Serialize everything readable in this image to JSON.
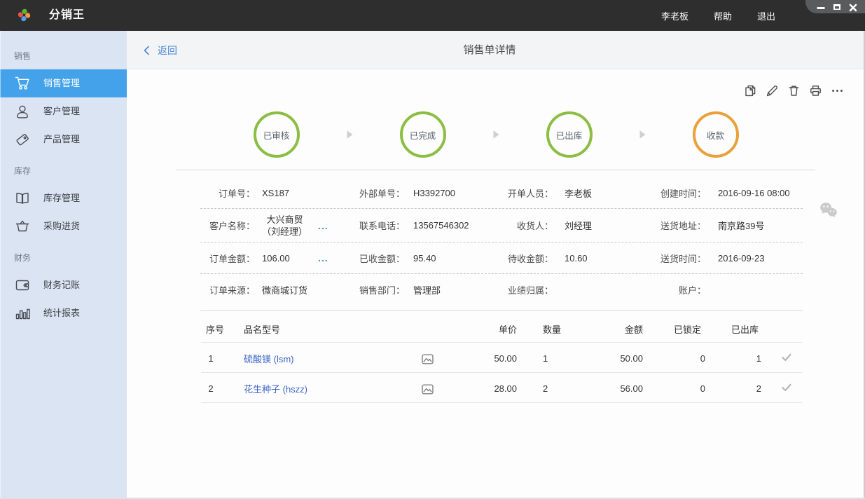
{
  "colors": {
    "topbar_bg": "#2e2e2e",
    "sidebar_bg": "#dbe4f2",
    "sidebar_active_bg": "#43a2e9",
    "header_bg": "#f3f4f5",
    "step_done": "#8cbe43",
    "step_pending": "#e9a13c",
    "back_link_blue": "#4a86d9",
    "product_link_blue": "#3c64c8",
    "more_dots_blue": "#4a90e2"
  },
  "topbar": {
    "logo_icon": "pinwheel-logo",
    "app_title": "分销王",
    "user": "李老板",
    "help": "帮助",
    "logout": "退出"
  },
  "window_controls": {
    "icons": [
      "minimize",
      "maximize",
      "close"
    ]
  },
  "sidebar": {
    "sections": [
      {
        "label": "销售",
        "items": [
          {
            "label": "销售管理",
            "icon": "cart",
            "active": true
          },
          {
            "label": "客户管理",
            "icon": "person",
            "active": false
          },
          {
            "label": "产品管理",
            "icon": "tag",
            "active": false
          }
        ]
      },
      {
        "label": "库存",
        "items": [
          {
            "label": "库存管理",
            "icon": "book",
            "active": false
          },
          {
            "label": "采购进货",
            "icon": "basket",
            "active": false
          }
        ]
      },
      {
        "label": "财务",
        "items": [
          {
            "label": "财务记账",
            "icon": "wallet",
            "active": false
          },
          {
            "label": "统计报表",
            "icon": "barchart",
            "active": false
          }
        ]
      }
    ]
  },
  "page_header": {
    "back_label": "返回",
    "title": "销售单详情"
  },
  "toolbar": {
    "icons": [
      "copy",
      "edit",
      "delete",
      "print",
      "more"
    ]
  },
  "steps": {
    "items": [
      {
        "label": "已审核",
        "state": "done"
      },
      {
        "label": "已完成",
        "state": "done"
      },
      {
        "label": "已出库",
        "state": "done"
      },
      {
        "label": "收款",
        "state": "pending"
      }
    ]
  },
  "order_fields": {
    "rows": [
      [
        {
          "label": "订单号：",
          "value": "XS187"
        },
        {
          "label": "外部单号：",
          "value": "H3392700"
        },
        {
          "label": "开单人员：",
          "value": "李老板"
        },
        {
          "label": "创建时间：",
          "value": "2016-09-16 08:00"
        }
      ],
      [
        {
          "label": "客户名称：",
          "value": "大兴商贸",
          "value2": "（刘经理）",
          "more": true
        },
        {
          "label": "联系电话：",
          "value": "13567546302"
        },
        {
          "label": "收货人：",
          "value": "刘经理"
        },
        {
          "label": "送货地址：",
          "value": "南京路39号"
        }
      ],
      [
        {
          "label": "订单金额：",
          "value": "106.00",
          "more": true
        },
        {
          "label": "已收金额：",
          "value": "95.40"
        },
        {
          "label": "待收金额：",
          "value": "10.60"
        },
        {
          "label": "送货时间：",
          "value": "2016-09-23"
        }
      ],
      [
        {
          "label": "订单来源：",
          "value": "微商城订货"
        },
        {
          "label": "销售部门：",
          "value": "管理部"
        },
        {
          "label": "业绩归属：",
          "value": ""
        },
        {
          "label": "账户：",
          "value": ""
        }
      ]
    ]
  },
  "items_table": {
    "columns": [
      "序号",
      "品名型号",
      "",
      "单价",
      "数量",
      "金额",
      "已锁定",
      "已出库",
      ""
    ],
    "rows": [
      {
        "seq": "1",
        "name": "硫酸镁 (lsm)",
        "has_image": true,
        "price": "50.00",
        "qty": "1",
        "amount": "50.00",
        "locked": "0",
        "out": "1",
        "checked": true
      },
      {
        "seq": "2",
        "name": "花生种子 (hszz)",
        "has_image": true,
        "price": "28.00",
        "qty": "2",
        "amount": "56.00",
        "locked": "0",
        "out": "2",
        "checked": true
      }
    ]
  }
}
